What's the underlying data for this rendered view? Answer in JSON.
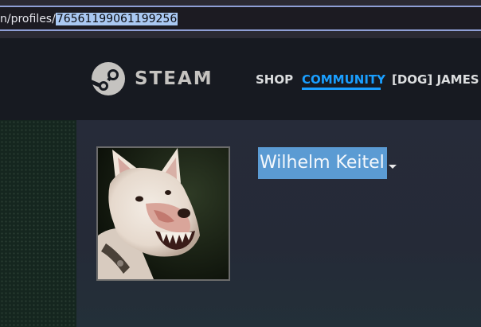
{
  "browser": {
    "url_prefix": "n/profiles/",
    "url_selected": "76561199061199256"
  },
  "steam_header": {
    "logo_text": "STEAM",
    "logo_tm": "®",
    "nav": {
      "shop": "SHOP",
      "community": "COMMUNITY",
      "user": "[DOG] JAMES T"
    },
    "accent_color": "#1a9fff"
  },
  "profile": {
    "persona_name": "Wilhelm Keitel",
    "avatar_icon": "dog-avatar-image",
    "menu_icon": "caret-down-icon",
    "selection_color": "#5b9bd3"
  }
}
